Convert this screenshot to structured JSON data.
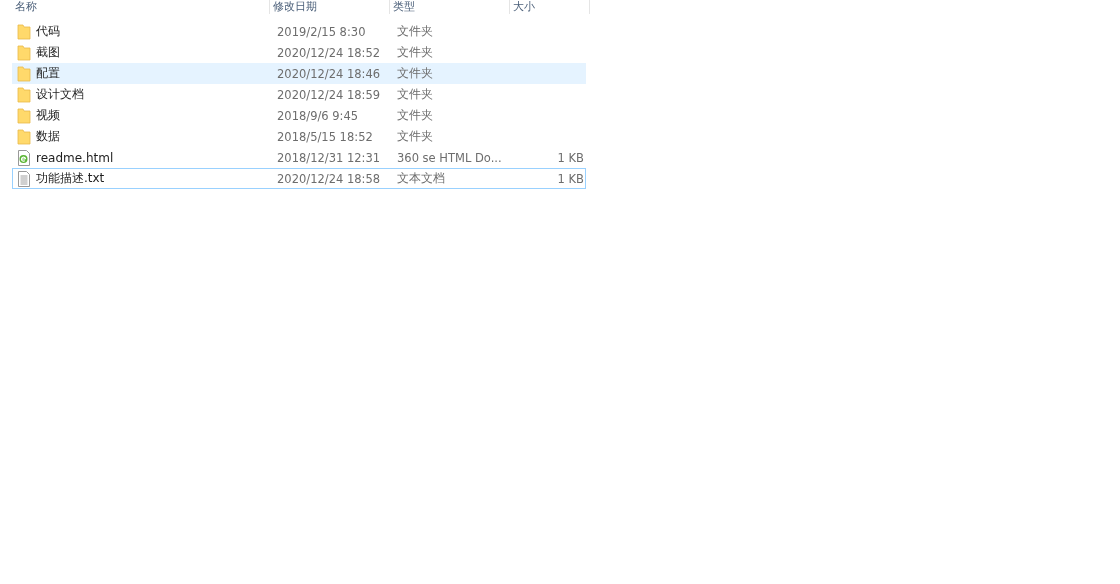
{
  "columns": [
    "名称",
    "修改日期",
    "类型",
    "大小"
  ],
  "rows": [
    {
      "kind": "folder",
      "name": "代码",
      "modified": "2019/2/15 8:30",
      "type": "文件夹",
      "highlighted": false,
      "focused": false
    },
    {
      "kind": "folder",
      "name": "截图",
      "modified": "2020/12/24 18:52",
      "type": "文件夹",
      "highlighted": false,
      "focused": false
    },
    {
      "kind": "folder",
      "name": "配置",
      "modified": "2020/12/24 18:46",
      "type": "文件夹",
      "highlighted": true,
      "focused": false
    },
    {
      "kind": "folder",
      "name": "设计文档",
      "modified": "2020/12/24 18:59",
      "type": "文件夹",
      "highlighted": false,
      "focused": false
    },
    {
      "kind": "folder",
      "name": "视频",
      "modified": "2018/9/6 9:45",
      "type": "文件夹",
      "highlighted": false,
      "focused": false
    },
    {
      "kind": "folder",
      "name": "数据",
      "modified": "2018/5/15 18:52",
      "type": "文件夹",
      "highlighted": false,
      "focused": false
    },
    {
      "kind": "html",
      "name": "readme.html",
      "modified": "2018/12/31 12:31",
      "type": "360 se HTML Do...",
      "size": "1 KB",
      "highlighted": false,
      "focused": false
    },
    {
      "kind": "text",
      "name": "功能描述.txt",
      "modified": "2020/12/24 18:58",
      "type": "文本文档",
      "size": "1 KB",
      "highlighted": false,
      "focused": true
    }
  ]
}
